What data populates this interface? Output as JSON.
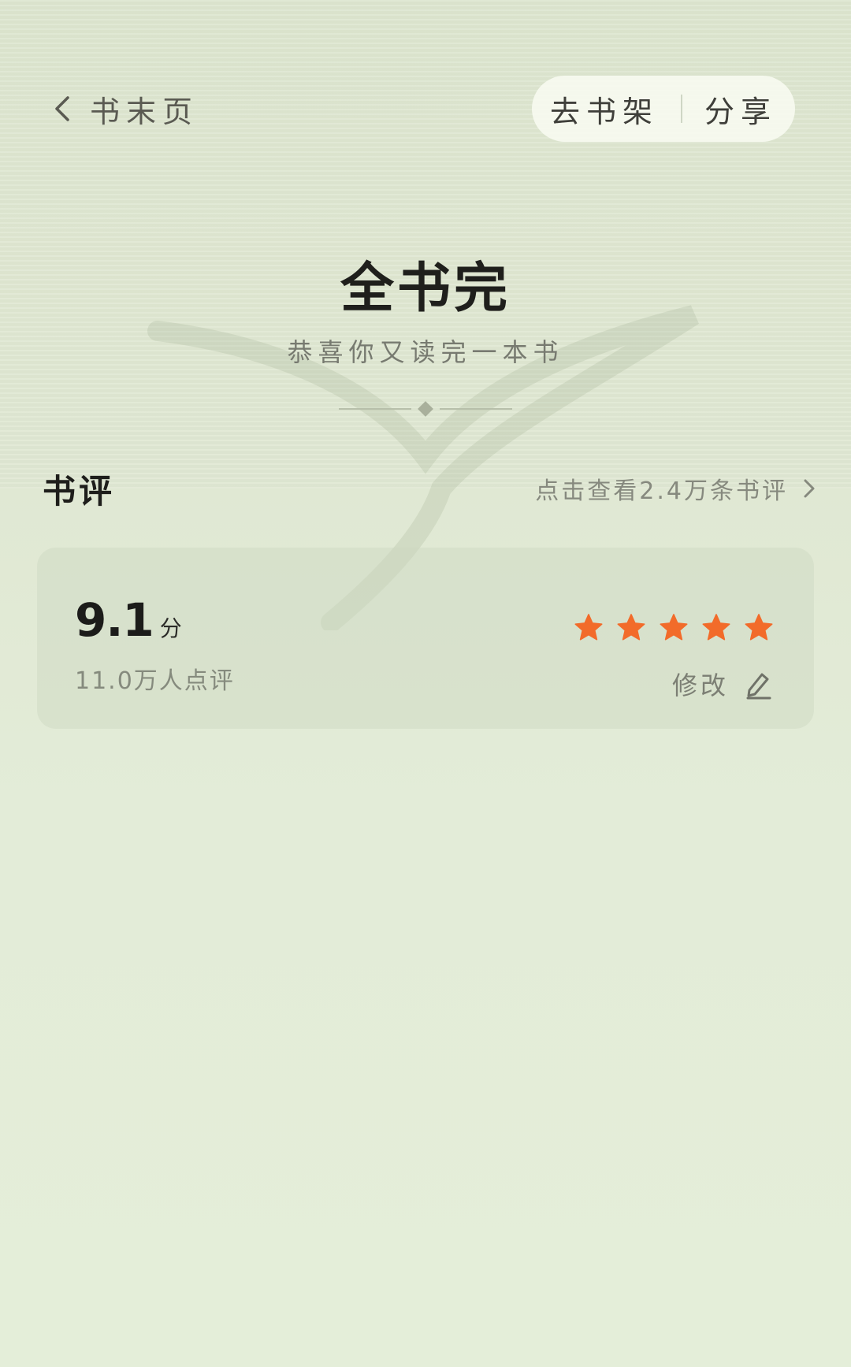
{
  "colors": {
    "star": "#f26b2a",
    "background": "#e1e9d4",
    "pill": "#f7faf0",
    "card": "#d2dbc6"
  },
  "top_bar": {
    "back_icon": "chevron-left-icon",
    "back_label": "书末页",
    "shelf_label": "去书架",
    "share_label": "分享"
  },
  "hero": {
    "title": "全书完",
    "subtitle": "恭喜你又读完一本书"
  },
  "reviews": {
    "title": "书评",
    "link_text": "点击查看2.4万条书评",
    "link_icon": "chevron-right-icon"
  },
  "rating": {
    "score": "9.1",
    "score_unit": "分",
    "count_text": "11.0万人点评",
    "stars_filled": 5,
    "stars_total": 5,
    "edit_label": "修改",
    "edit_icon": "pencil-icon"
  }
}
